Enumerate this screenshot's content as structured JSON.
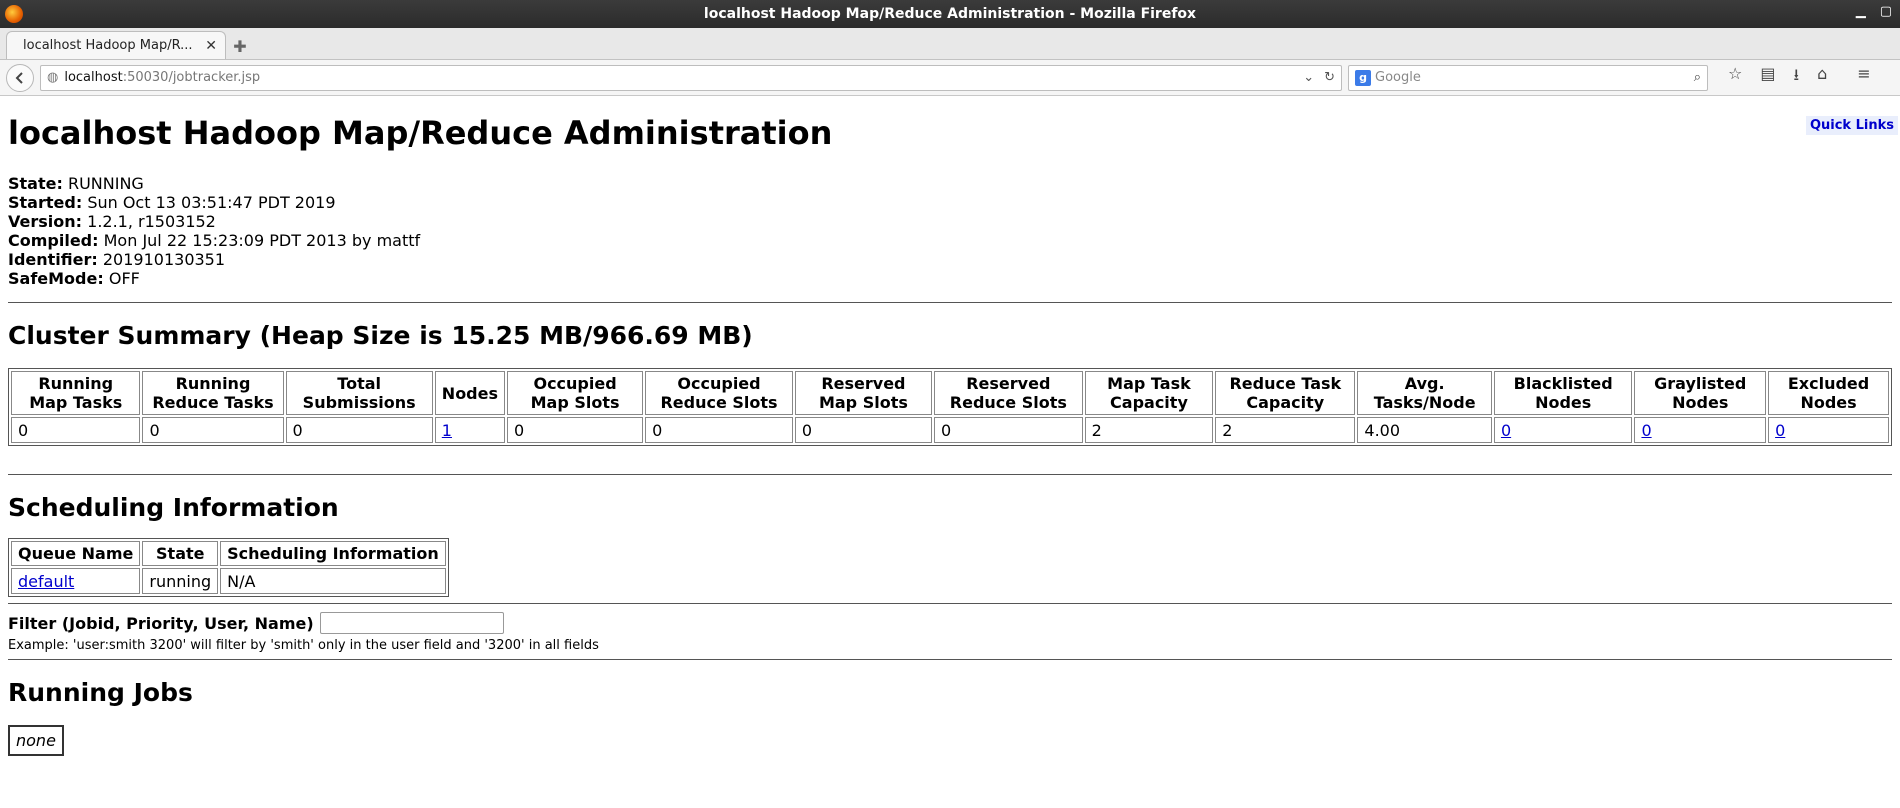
{
  "browser": {
    "window_title": "localhost Hadoop Map/Reduce Administration - Mozilla Firefox",
    "tab_title": "localhost Hadoop Map/R...",
    "tab_close": "✕",
    "new_tab": "✚",
    "url_host": "localhost",
    "url_rest": ":50030/jobtracker.jsp",
    "search_placeholder": "Google"
  },
  "page": {
    "quick_links": "Quick Links",
    "title": "localhost Hadoop Map/Reduce Administration",
    "status": [
      {
        "label": "State:",
        "value": "RUNNING"
      },
      {
        "label": "Started:",
        "value": "Sun Oct 13 03:51:47 PDT 2019"
      },
      {
        "label": "Version:",
        "value": "1.2.1, r1503152"
      },
      {
        "label": "Compiled:",
        "value": "Mon Jul 22 15:23:09 PDT 2013 by mattf"
      },
      {
        "label": "Identifier:",
        "value": "201910130351"
      },
      {
        "label": "SafeMode:",
        "value": "OFF"
      }
    ]
  },
  "cluster": {
    "heading": "Cluster Summary (Heap Size is 15.25 MB/966.69 MB)",
    "headers": [
      "Running Map Tasks",
      "Running Reduce Tasks",
      "Total Submissions",
      "Nodes",
      "Occupied Map Slots",
      "Occupied Reduce Slots",
      "Reserved Map Slots",
      "Reserved Reduce Slots",
      "Map Task Capacity",
      "Reduce Task Capacity",
      "Avg. Tasks/Node",
      "Blacklisted Nodes",
      "Graylisted Nodes",
      "Excluded Nodes"
    ],
    "values": [
      "0",
      "0",
      "0",
      "1",
      "0",
      "0",
      "0",
      "0",
      "2",
      "2",
      "4.00",
      "0",
      "0",
      "0"
    ]
  },
  "scheduling": {
    "heading": "Scheduling Information",
    "headers": [
      "Queue Name",
      "State",
      "Scheduling Information"
    ],
    "row": [
      "default",
      "running",
      "N/A"
    ]
  },
  "filter": {
    "label": "Filter (Jobid, Priority, User, Name)",
    "value": "",
    "example": "Example: 'user:smith 3200' will filter by 'smith' only in the user field and '3200' in all fields"
  },
  "running_jobs": {
    "heading": "Running Jobs",
    "empty": "none"
  }
}
